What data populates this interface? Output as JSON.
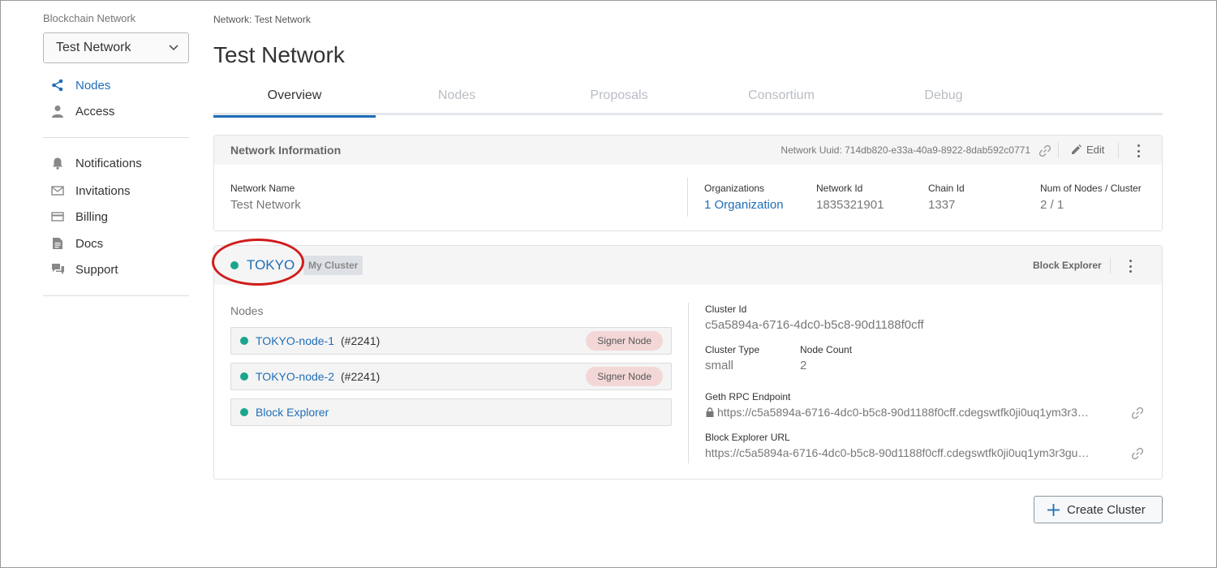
{
  "sidebar": {
    "section_label": "Blockchain Network",
    "network_select": {
      "value": "Test Network"
    },
    "primary_items": [
      {
        "label": "Nodes",
        "icon": "share-icon",
        "active": true
      },
      {
        "label": "Access",
        "icon": "user-icon",
        "active": false
      }
    ],
    "secondary_items": [
      {
        "label": "Notifications",
        "icon": "bell-icon"
      },
      {
        "label": "Invitations",
        "icon": "envelope-icon"
      },
      {
        "label": "Billing",
        "icon": "credit-card-icon"
      },
      {
        "label": "Docs",
        "icon": "document-icon"
      },
      {
        "label": "Support",
        "icon": "chat-icon"
      }
    ]
  },
  "breadcrumb": "Network: Test Network",
  "page_title": "Test Network",
  "tabs": [
    {
      "label": "Overview",
      "active": true
    },
    {
      "label": "Nodes",
      "active": false
    },
    {
      "label": "Proposals",
      "active": false
    },
    {
      "label": "Consortium",
      "active": false
    },
    {
      "label": "Debug",
      "active": false
    }
  ],
  "network_info": {
    "title": "Network Information",
    "uuid_text": "Network Uuid: 714db820-e33a-40a9-8922-8dab592c0771",
    "edit_label": "Edit",
    "network_name_label": "Network Name",
    "network_name_value": "Test Network",
    "organizations_label": "Organizations",
    "organizations_value": "1 Organization",
    "network_id_label": "Network Id",
    "network_id_value": "1835321901",
    "chain_id_label": "Chain Id",
    "chain_id_value": "1337",
    "nodes_per_cluster_label": "Num of Nodes / Cluster",
    "nodes_per_cluster_value": "2 / 1"
  },
  "cluster": {
    "name": "TOKYO",
    "badge": "My Cluster",
    "block_explorer_label": "Block Explorer",
    "nodes_title": "Nodes",
    "nodes": [
      {
        "name": "TOKYO-node-1",
        "id": "(#2241)",
        "badge": "Signer Node"
      },
      {
        "name": "TOKYO-node-2",
        "id": "(#2241)",
        "badge": "Signer Node"
      },
      {
        "name": "Block Explorer",
        "id": "",
        "badge": ""
      }
    ],
    "cluster_id_label": "Cluster Id",
    "cluster_id_value": "c5a5894a-6716-4dc0-b5c8-90d1188f0cff",
    "cluster_type_label": "Cluster Type",
    "cluster_type_value": "small",
    "node_count_label": "Node Count",
    "node_count_value": "2",
    "geth_rpc_label": "Geth RPC Endpoint",
    "geth_rpc_value": "https://c5a5894a-6716-4dc0-b5c8-90d1188f0cff.cdegswtfk0ji0uq1ym3r3…",
    "block_explorer_url_label": "Block Explorer URL",
    "block_explorer_url_value": "https://c5a5894a-6716-4dc0-b5c8-90d1188f0cff.cdegswtfk0ji0uq1ym3r3gu…"
  },
  "create_cluster_label": "Create Cluster",
  "colors": {
    "accent": "#1f6eb7",
    "status_ok": "#1ba58d",
    "highlight": "#d11c1c"
  }
}
